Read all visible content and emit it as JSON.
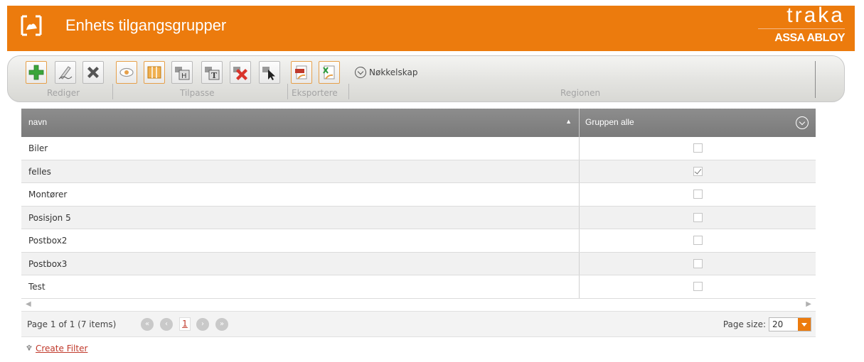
{
  "header": {
    "title": "Enhets tilgangsgrupper",
    "brand_top": "traka",
    "brand_bottom": "ASSA ABLOY",
    "color": "#ec7b0d"
  },
  "toolbar": {
    "groups": {
      "edit": "Rediger",
      "customize": "Tilpasse",
      "export": "Eksportere",
      "region": "Regionen"
    },
    "scope_label": "Nøkkelskap",
    "icons": [
      "add-icon",
      "edit-icon",
      "delete-icon",
      "view-icon",
      "columns-icon",
      "save-layout-icon",
      "text-icon",
      "clear-icon",
      "select-icon",
      "export-pdf-icon",
      "export-excel-icon"
    ]
  },
  "grid": {
    "columns": [
      "navn",
      "Gruppen alle"
    ],
    "rows": [
      {
        "name": "Biler",
        "checked": false
      },
      {
        "name": "felles",
        "checked": true
      },
      {
        "name": "Montører",
        "checked": false
      },
      {
        "name": "Posisjon 5",
        "checked": false
      },
      {
        "name": "Postbox2",
        "checked": false
      },
      {
        "name": "Postbox3",
        "checked": false
      },
      {
        "name": "Test",
        "checked": false
      }
    ]
  },
  "pager": {
    "summary": "Page 1 of 1 (7 items)",
    "current_page": "1",
    "page_size_label": "Page size:",
    "page_size": "20"
  },
  "filter": {
    "link": "Create Filter"
  }
}
